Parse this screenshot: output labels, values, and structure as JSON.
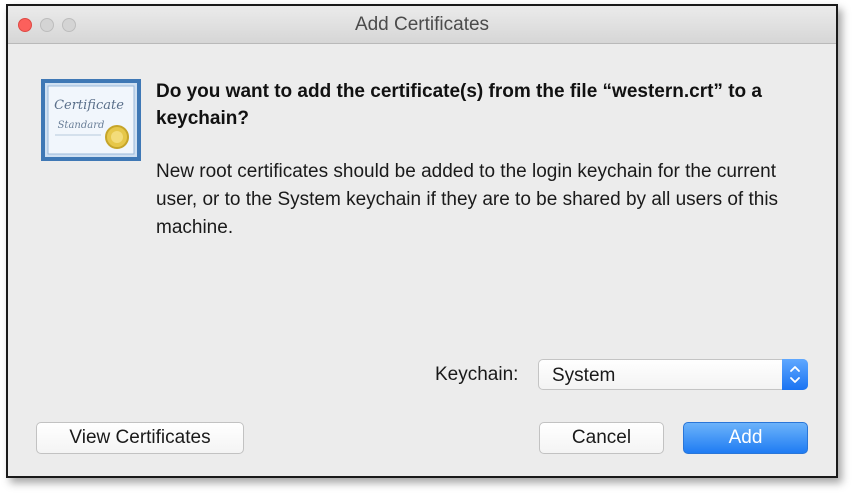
{
  "window": {
    "title": "Add Certificates"
  },
  "icon": {
    "name": "certificate-icon",
    "line1": "Certificate",
    "line2": "Standard"
  },
  "dialog": {
    "heading": "Do you want to add the certificate(s) from the file “western.crt” to a keychain?",
    "message": "New root certificates should be added to the login keychain for the current user, or to the System keychain if they are to be shared by all users of this machine."
  },
  "keychain": {
    "label": "Keychain:",
    "value": "System"
  },
  "buttons": {
    "view": "View Certificates",
    "cancel": "Cancel",
    "add": "Add"
  },
  "colors": {
    "accent": "#1f7cf3",
    "close_light": "#fc605c"
  }
}
